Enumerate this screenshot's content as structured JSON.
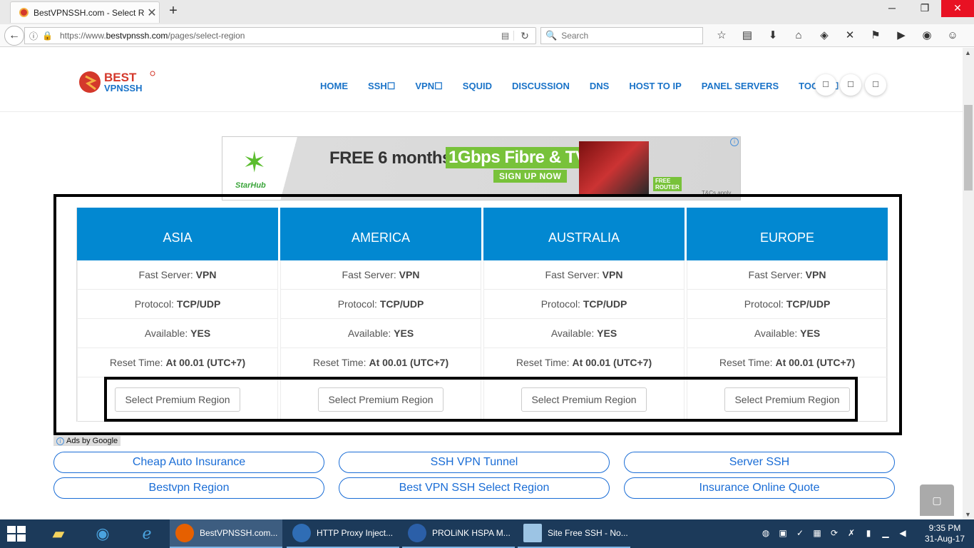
{
  "browser": {
    "tab_title": "BestVPNSSH.com - Select Re",
    "tab_close": "✕",
    "new_tab": "+",
    "url_prefix": "https://www.",
    "url_domain": "bestvpnssh.com",
    "url_path": "/pages/select-region",
    "search_placeholder": "Search",
    "window_buttons": [
      "─",
      "❐",
      "✕"
    ]
  },
  "site": {
    "logo_text_top": "BEST",
    "logo_text_bottom": "VPNSSH",
    "nav": [
      "HOME",
      "SSH☐",
      "VPN☐",
      "SQUID",
      "DISCUSSION",
      "DNS",
      "HOST TO IP",
      "PANEL SERVERS",
      "TOOLS☐"
    ],
    "circle_buttons": [
      "☐",
      "☐",
      "☐"
    ]
  },
  "ad": {
    "brand": "StarHub",
    "headline": "FREE 6 months",
    "highlight": "1Gbps Fibre & TV",
    "cta": "SIGN UP NOW",
    "badge": "FREE ROUTER",
    "tcs": "T&Cs apply",
    "info": "i"
  },
  "regions": [
    {
      "name": "ASIA",
      "fast_label": "Fast Server: ",
      "fast_value": "VPN",
      "protocol_label": "Protocol: ",
      "protocol_value": "TCP/UDP",
      "available_label": "Available: ",
      "available_value": "YES",
      "reset_label": "Reset Time: ",
      "reset_value": "At 00.01 (UTC+7)",
      "button": "Select Premium Region"
    },
    {
      "name": "AMERICA",
      "fast_label": "Fast Server: ",
      "fast_value": "VPN",
      "protocol_label": "Protocol: ",
      "protocol_value": "TCP/UDP",
      "available_label": "Available: ",
      "available_value": "YES",
      "reset_label": "Reset Time: ",
      "reset_value": "At 00.01 (UTC+7)",
      "button": "Select Premium Region"
    },
    {
      "name": "AUSTRALIA",
      "fast_label": "Fast Server: ",
      "fast_value": "VPN",
      "protocol_label": "Protocol: ",
      "protocol_value": "TCP/UDP",
      "available_label": "Available: ",
      "available_value": "YES",
      "reset_label": "Reset Time: ",
      "reset_value": "At 00.01 (UTC+7)",
      "button": "Select Premium Region"
    },
    {
      "name": "EUROPE",
      "fast_label": "Fast Server: ",
      "fast_value": "VPN",
      "protocol_label": "Protocol: ",
      "protocol_value": "TCP/UDP",
      "available_label": "Available: ",
      "available_value": "YES",
      "reset_label": "Reset Time: ",
      "reset_value": "At 00.01 (UTC+7)",
      "button": "Select Premium Region"
    }
  ],
  "ads_by_google": "Ads by Google",
  "ad_links": [
    "Cheap Auto Insurance",
    "SSH VPN Tunnel",
    "Server SSH",
    "Bestvpn Region",
    "Best VPN SSH Select Region",
    "Insurance Online Quote"
  ],
  "taskbar": {
    "items": [
      "BestVPNSSH.com...",
      "HTTP Proxy Inject...",
      "PROLiNK HSPA M...",
      "Site Free SSH - No..."
    ],
    "time": "9:35 PM",
    "date": "31-Aug-17"
  },
  "colors": {
    "region_header": "#0288d1",
    "link_blue": "#1a6dd6",
    "nav_blue": "#1a73c8",
    "taskbar": "#1c3a5a",
    "close_red": "#e81123"
  }
}
